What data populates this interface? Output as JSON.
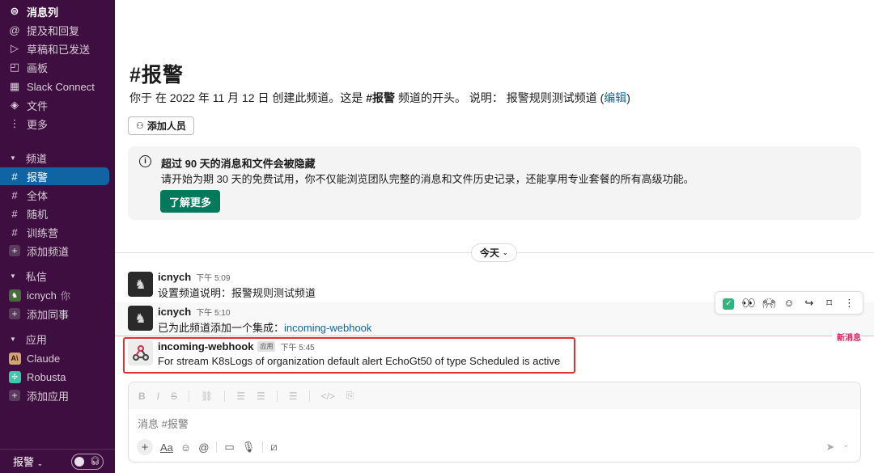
{
  "sidebar": {
    "top_items": [
      {
        "label": "消息列",
        "icon": "threads-icon"
      },
      {
        "label": "提及和回复",
        "icon": "at-icon"
      },
      {
        "label": "草稿和已发送",
        "icon": "send-icon"
      },
      {
        "label": "画板",
        "icon": "canvas-icon"
      },
      {
        "label": "Slack Connect",
        "icon": "building-icon"
      },
      {
        "label": "文件",
        "icon": "layers-icon"
      },
      {
        "label": "更多",
        "icon": "more-vertical-icon"
      }
    ],
    "channels_header": "频道",
    "channels": [
      {
        "label": "报警"
      },
      {
        "label": "全体"
      },
      {
        "label": "随机"
      },
      {
        "label": "训练营"
      }
    ],
    "add_channel": "添加频道",
    "dms_header": "私信",
    "dms": [
      {
        "label": "icnych",
        "suffix": "你"
      }
    ],
    "add_colleague": "添加同事",
    "apps_header": "应用",
    "apps": [
      {
        "label": "Claude",
        "badge": "A\\"
      },
      {
        "label": "Robusta"
      }
    ],
    "add_app": "添加应用",
    "workspace": "报警"
  },
  "channel": {
    "title": "#报警",
    "intro_prefix": "你于 在 2022 年 11 月 12 日 创建此频道。这是 ",
    "intro_channel": "#报警",
    "intro_mid": " 频道的开头。 说明： 报警规则测试频道 (",
    "intro_edit": "编辑",
    "intro_suffix": ")",
    "add_member": "添加人员"
  },
  "notice": {
    "title": "超过 90 天的消息和文件会被隐藏",
    "body": "请开始为期 30 天的免费试用，你不仅能浏览团队完整的消息和文件历史记录，还能享用专业套餐的所有高级功能。",
    "button": "了解更多"
  },
  "date_divider": "今天",
  "messages": [
    {
      "user": "icnych",
      "time": "下午 5:09",
      "text": "设置频道说明：报警规则测试频道"
    },
    {
      "user": "icnych",
      "time": "下午 5:10",
      "text_prefix": "已为此频道添加一个集成：",
      "link": "incoming-webhook"
    },
    {
      "user": "incoming-webhook",
      "badge": "应用",
      "time": "下午 5:45",
      "text": "For stream K8sLogs of organization default alert EchoGt50 of type Scheduled is active"
    }
  ],
  "new_messages_label": "新消息",
  "composer": {
    "placeholder": "消息 #报警"
  },
  "colors": {
    "sidebar_bg": "#3f0e40",
    "active_item": "#1164a3",
    "primary_button": "#007a5a",
    "link": "#1264a3",
    "new_message": "#e01e5a",
    "highlight_border": "#e0312f"
  }
}
